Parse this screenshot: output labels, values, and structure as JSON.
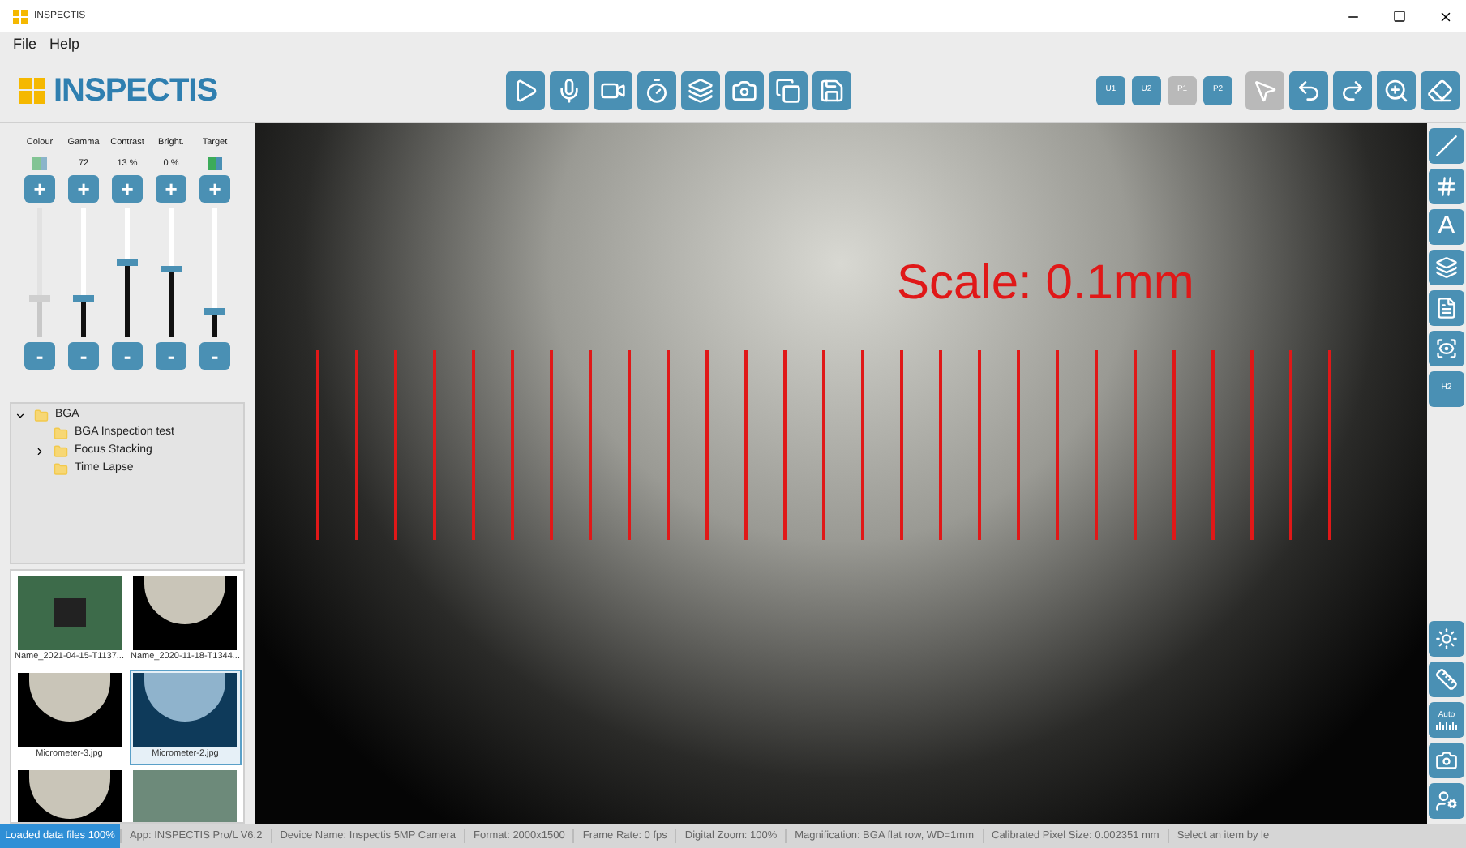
{
  "window": {
    "title": "INSPECTIS"
  },
  "menu": [
    "File",
    "Help"
  ],
  "logo": "INSPECTIS",
  "toolbar_left": [
    {
      "kind": "play"
    },
    {
      "kind": "mic"
    },
    {
      "kind": "video"
    },
    {
      "kind": "timer"
    },
    {
      "kind": "stack"
    },
    {
      "kind": "camera"
    },
    {
      "kind": "copy"
    },
    {
      "kind": "save"
    }
  ],
  "presets": [
    {
      "label": "U1",
      "disabled": false
    },
    {
      "label": "U2",
      "disabled": false
    },
    {
      "label": "P1",
      "disabled": true
    },
    {
      "label": "P2",
      "disabled": false
    }
  ],
  "toolbar_right": [
    {
      "kind": "pointer",
      "disabled": true
    },
    {
      "kind": "undo",
      "disabled": false
    },
    {
      "kind": "redo",
      "disabled": false
    },
    {
      "kind": "zoom",
      "disabled": false
    },
    {
      "kind": "eraser",
      "disabled": false
    }
  ],
  "sliders": [
    {
      "label": "Colour",
      "kind": "toggle",
      "disabled": true,
      "level": 0.3
    },
    {
      "label": "Gamma",
      "kind": "value",
      "reading": "72",
      "disabled": false,
      "level": 0.3
    },
    {
      "label": "Contrast",
      "kind": "value",
      "reading": "13 %",
      "disabled": false,
      "level": 0.58
    },
    {
      "label": "Bright.",
      "kind": "value",
      "reading": "0 %",
      "disabled": false,
      "level": 0.52
    },
    {
      "label": "Target",
      "kind": "toggle",
      "disabled": false,
      "level": 0.2
    }
  ],
  "slider_buttons": {
    "plus": "+",
    "minus": "-"
  },
  "tree": [
    {
      "label": "BGA",
      "expanded": true,
      "children": [
        {
          "label": "BGA Inspection test"
        },
        {
          "label": "Focus Stacking",
          "expanded": false
        },
        {
          "label": "Time Lapse"
        }
      ]
    }
  ],
  "thumbnails": [
    {
      "caption": "Name_2021-04-15-T1137...",
      "kind": "board",
      "selected": false
    },
    {
      "caption": "Name_2020-11-18-T1344...",
      "kind": "dome",
      "selected": false
    },
    {
      "caption": "Micrometer-3.jpg",
      "kind": "dome",
      "selected": false
    },
    {
      "caption": "Micrometer-2.jpg",
      "kind": "dome",
      "selected": true
    },
    {
      "kind": "dome",
      "selected": false
    },
    {
      "kind": "leds",
      "selected": false
    }
  ],
  "viewer": {
    "overlay": "Scale: 0.1mm"
  },
  "side_tools": [
    {
      "kind": "line"
    },
    {
      "kind": "grid"
    },
    {
      "kind": "text",
      "label": "A"
    },
    {
      "kind": "layers"
    },
    {
      "kind": "document"
    },
    {
      "kind": "focus"
    },
    {
      "kind": "label",
      "label": "H2"
    }
  ],
  "side_tools_bottom": [
    {
      "kind": "light"
    },
    {
      "kind": "ruler"
    },
    {
      "kind": "auto",
      "label": "Auto"
    },
    {
      "kind": "camera-gear"
    },
    {
      "kind": "user-gear"
    }
  ],
  "status_bar": {
    "progress": "Loaded data files 100%",
    "items": [
      "App: INSPECTIS Pro/L V6.2",
      "Device Name: Inspectis 5MP Camera",
      "Format: 2000x1500",
      "Frame Rate: 0 fps",
      "Digital Zoom: 100%",
      "Magnification: BGA flat row, WD=1mm",
      "Calibrated Pixel Size: 0.002351 mm",
      "Select an item by le"
    ]
  }
}
